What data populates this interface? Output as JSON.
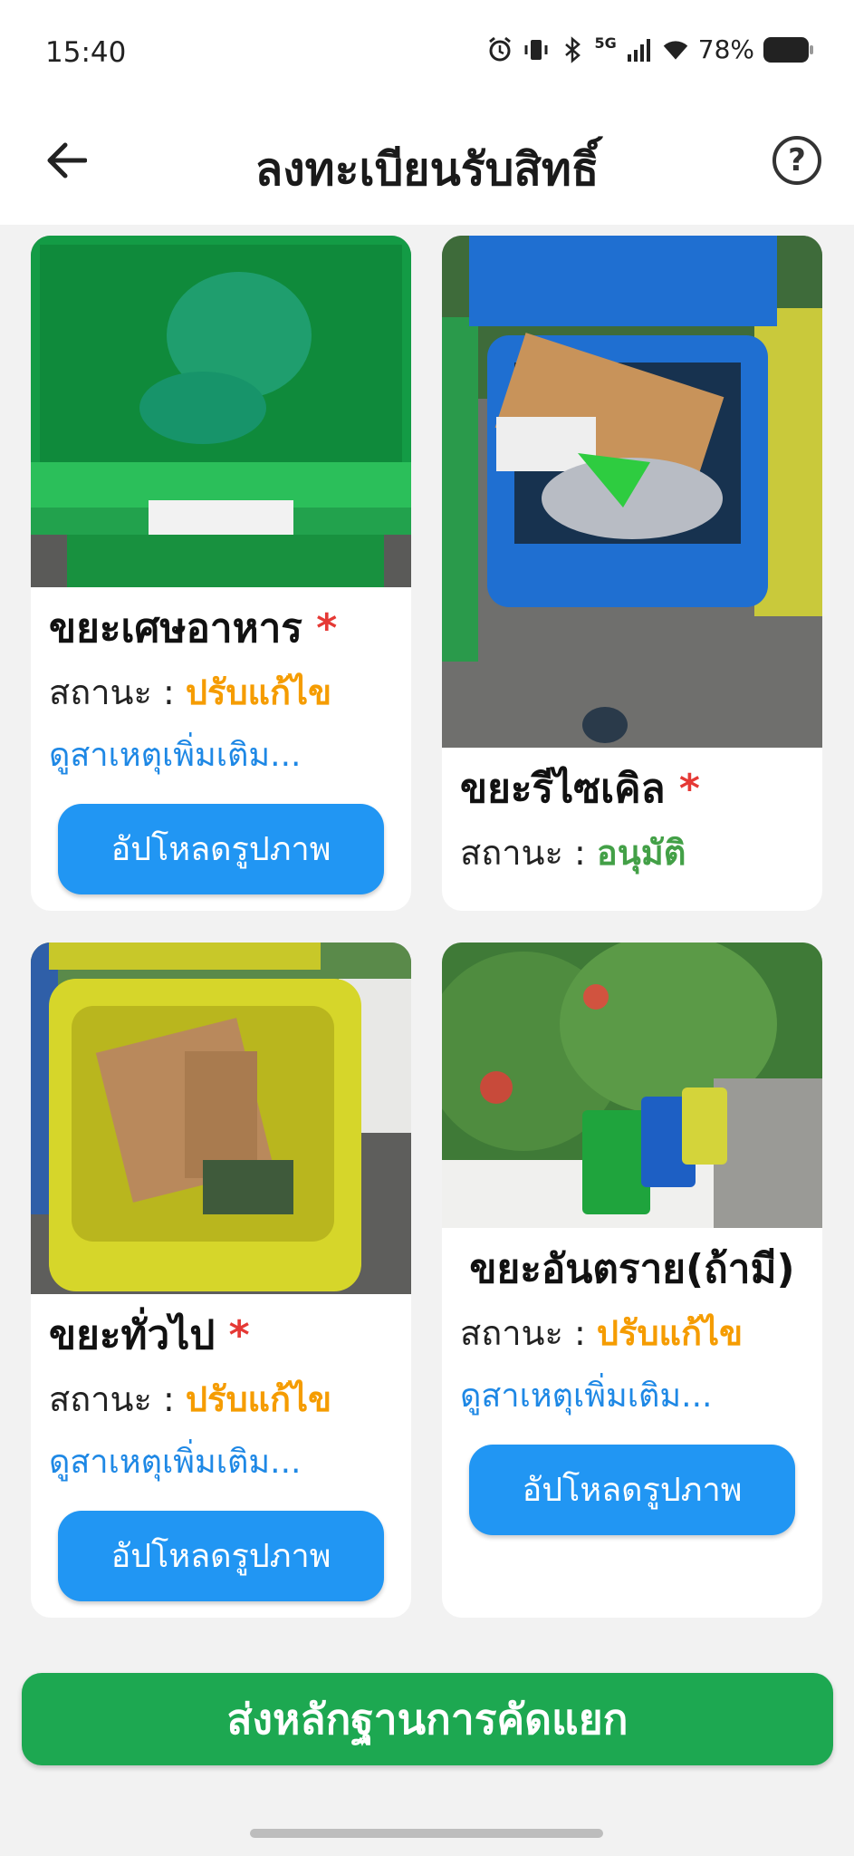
{
  "status_bar": {
    "time": "15:40",
    "battery_percent": "78%",
    "network": "5G"
  },
  "header": {
    "title": "ลงทะเบียนรับสิทธิ์",
    "help": "?"
  },
  "colors": {
    "accent_blue": "#2196f3",
    "submit_green": "#1da851",
    "status_fix": "#f59c00",
    "status_ok": "#43a047",
    "required": "#e53935"
  },
  "cards": [
    {
      "title": "ขยะเศษอาหาร",
      "required": "*",
      "status_label": "สถานะ :",
      "status_value": "ปรับแก้ไข",
      "more": "ดูสาเหตุเพิ่มเติม...",
      "button": "อัปโหลดรูปภาพ",
      "photo": "green-bin-photo"
    },
    {
      "title": "ขยะรีไซเคิล",
      "required": "*",
      "status_label": "สถานะ :",
      "status_value": "อนุมัติ",
      "photo": "blue-bin-photo"
    },
    {
      "title": "ขยะทั่วไป",
      "required": "*",
      "status_label": "สถานะ :",
      "status_value": "ปรับแก้ไข",
      "more": "ดูสาเหตุเพิ่มเติม...",
      "button": "อัปโหลดรูปภาพ",
      "photo": "yellow-bin-photo"
    },
    {
      "title": "ขยะอันตราย(ถ้ามี)",
      "status_label": "สถานะ :",
      "status_value": "ปรับแก้ไข",
      "more": "ดูสาเหตุเพิ่มเติม...",
      "button": "อัปโหลดรูปภาพ",
      "photo": "three-bins-photo"
    }
  ],
  "submit_button": "ส่งหลักฐานการคัดแยก"
}
